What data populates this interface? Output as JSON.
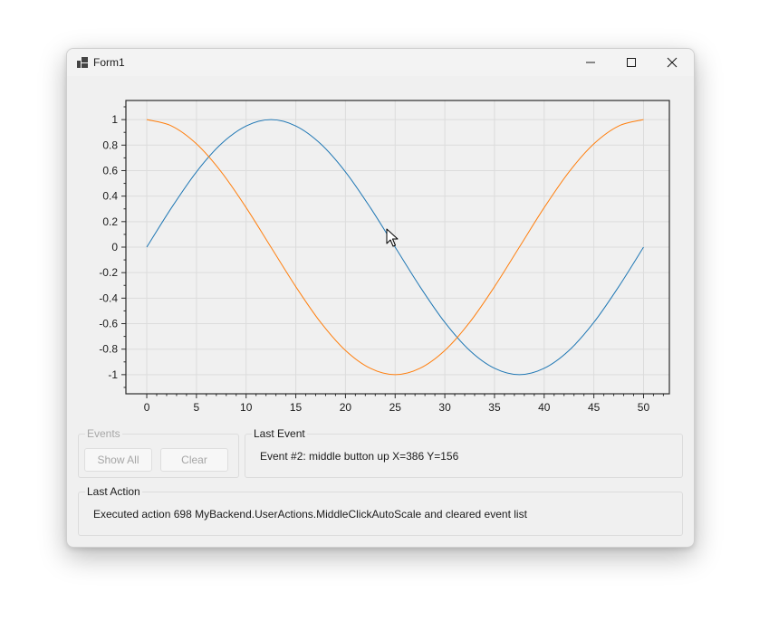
{
  "window": {
    "title": "Form1",
    "controls": {
      "minimize": "minimize",
      "maximize": "maximize",
      "close": "close"
    }
  },
  "chart_data": {
    "type": "line",
    "title": "",
    "xlabel": "",
    "ylabel": "",
    "xlim": [
      -2.1,
      52.6
    ],
    "ylim": [
      -1.15,
      1.15
    ],
    "x_ticks": [
      0,
      5,
      10,
      15,
      20,
      25,
      30,
      35,
      40,
      45,
      50
    ],
    "y_ticks": [
      1,
      0.8,
      0.6,
      0.4,
      0.2,
      0,
      -0.2,
      -0.4,
      -0.6,
      -0.8,
      -1
    ],
    "x_tick_labels": [
      "0",
      "5",
      "10",
      "15",
      "20",
      "25",
      "30",
      "35",
      "40",
      "45",
      "50"
    ],
    "y_tick_labels": [
      "1",
      "0.8",
      "0.6",
      "0.4",
      "0.2",
      "0",
      "-0.2",
      "-0.4",
      "-0.6",
      "-0.8",
      "-1"
    ],
    "grid": true,
    "series": [
      {
        "color": "#1f77b4",
        "x": [
          0,
          2.5,
          5,
          7.5,
          10,
          12.5,
          15,
          17.5,
          20,
          22.5,
          25,
          27.5,
          30,
          32.5,
          35,
          37.5,
          40,
          42.5,
          45,
          47.5,
          50
        ],
        "y": [
          0,
          0.31,
          0.59,
          0.81,
          0.95,
          1,
          0.95,
          0.81,
          0.59,
          0.31,
          0,
          -0.31,
          -0.59,
          -0.81,
          -0.95,
          -1,
          -0.95,
          -0.81,
          -0.59,
          -0.31,
          0
        ]
      },
      {
        "color": "#ff7f0e",
        "x": [
          0,
          2.5,
          5,
          7.5,
          10,
          12.5,
          15,
          17.5,
          20,
          22.5,
          25,
          27.5,
          30,
          32.5,
          35,
          37.5,
          40,
          42.5,
          45,
          47.5,
          50
        ],
        "y": [
          1,
          0.95,
          0.81,
          0.59,
          0.31,
          0,
          -0.31,
          -0.59,
          -0.81,
          -0.95,
          -1,
          -0.95,
          -0.81,
          -0.59,
          -0.31,
          0,
          0.31,
          0.59,
          0.81,
          0.95,
          1
        ]
      }
    ]
  },
  "events_group": {
    "legend": "Events",
    "show_all": "Show All",
    "clear": "Clear"
  },
  "last_event": {
    "legend": "Last Event",
    "text": "Event #2: middle button up X=386 Y=156"
  },
  "last_action": {
    "legend": "Last Action",
    "text": "Executed action 698 MyBackend.UserActions.MiddleClickAutoScale and cleared event list"
  },
  "icons": {
    "app": "app-icon",
    "cursor": "mouse-pointer-icon"
  }
}
